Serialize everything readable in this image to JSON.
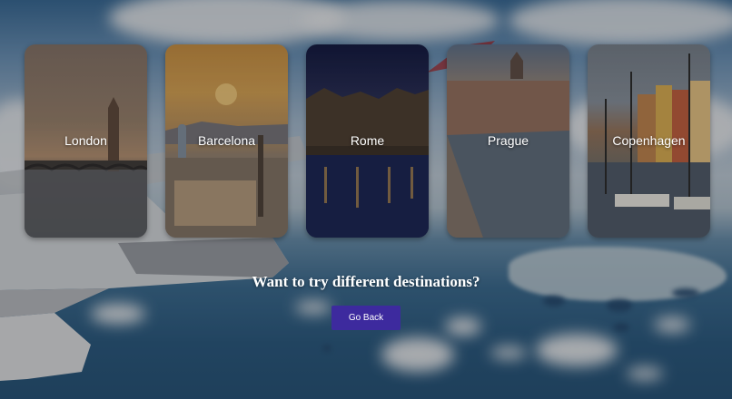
{
  "destinations": [
    {
      "label": "London"
    },
    {
      "label": "Barcelona"
    },
    {
      "label": "Rome"
    },
    {
      "label": "Prague"
    },
    {
      "label": "Copenhagen"
    }
  ],
  "cta": {
    "heading": "Want to try different destinations?",
    "back_label": "Go Back"
  },
  "colors": {
    "button_bg": "#3d2a9e",
    "text": "#ffffff"
  }
}
